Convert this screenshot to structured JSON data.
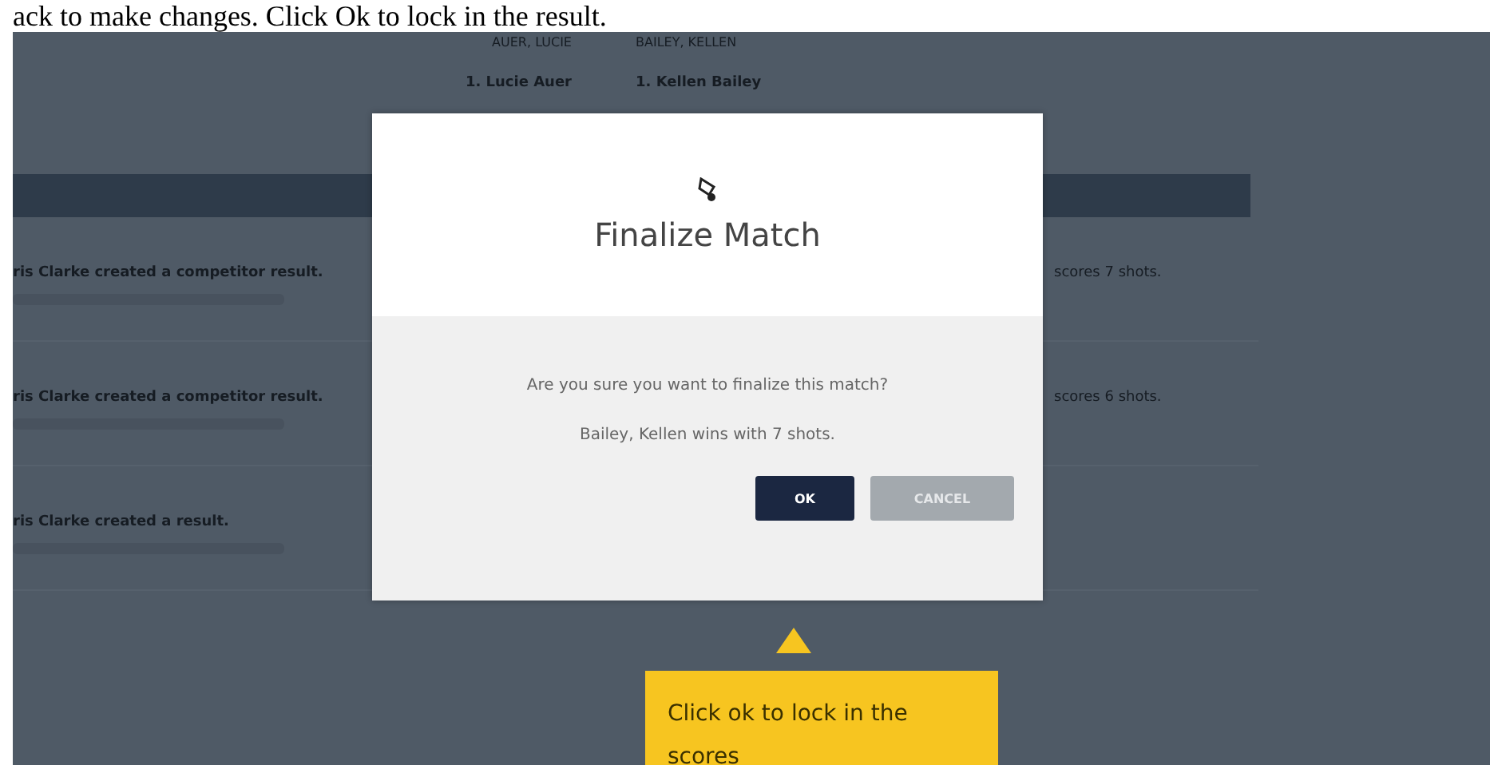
{
  "caption": "ack to make changes. Click Ok to lock in the result.",
  "background": {
    "players": [
      {
        "header": "AUER, LUCIE",
        "entry": "1. Lucie Auer"
      },
      {
        "header": "BAILEY, KELLEN",
        "entry": "1. Kellen Bailey"
      }
    ],
    "activity": [
      {
        "text": "ris Clarke created a competitor result.",
        "detail": "scores 7 shots."
      },
      {
        "text": "ris Clarke created a competitor result.",
        "detail": "scores 6 shots."
      },
      {
        "text": "ris Clarke created a result."
      }
    ]
  },
  "dialog": {
    "title": "Finalize Match",
    "message": "Are you sure you want to finalize this match?",
    "result": "Bailey, Kellen wins with 7 shots.",
    "buttons": [
      {
        "label": "OK",
        "kind": "primary"
      },
      {
        "label": "CANCEL",
        "kind": "secondary"
      }
    ]
  },
  "tooltip": {
    "text": "Click ok to lock in the scores"
  }
}
